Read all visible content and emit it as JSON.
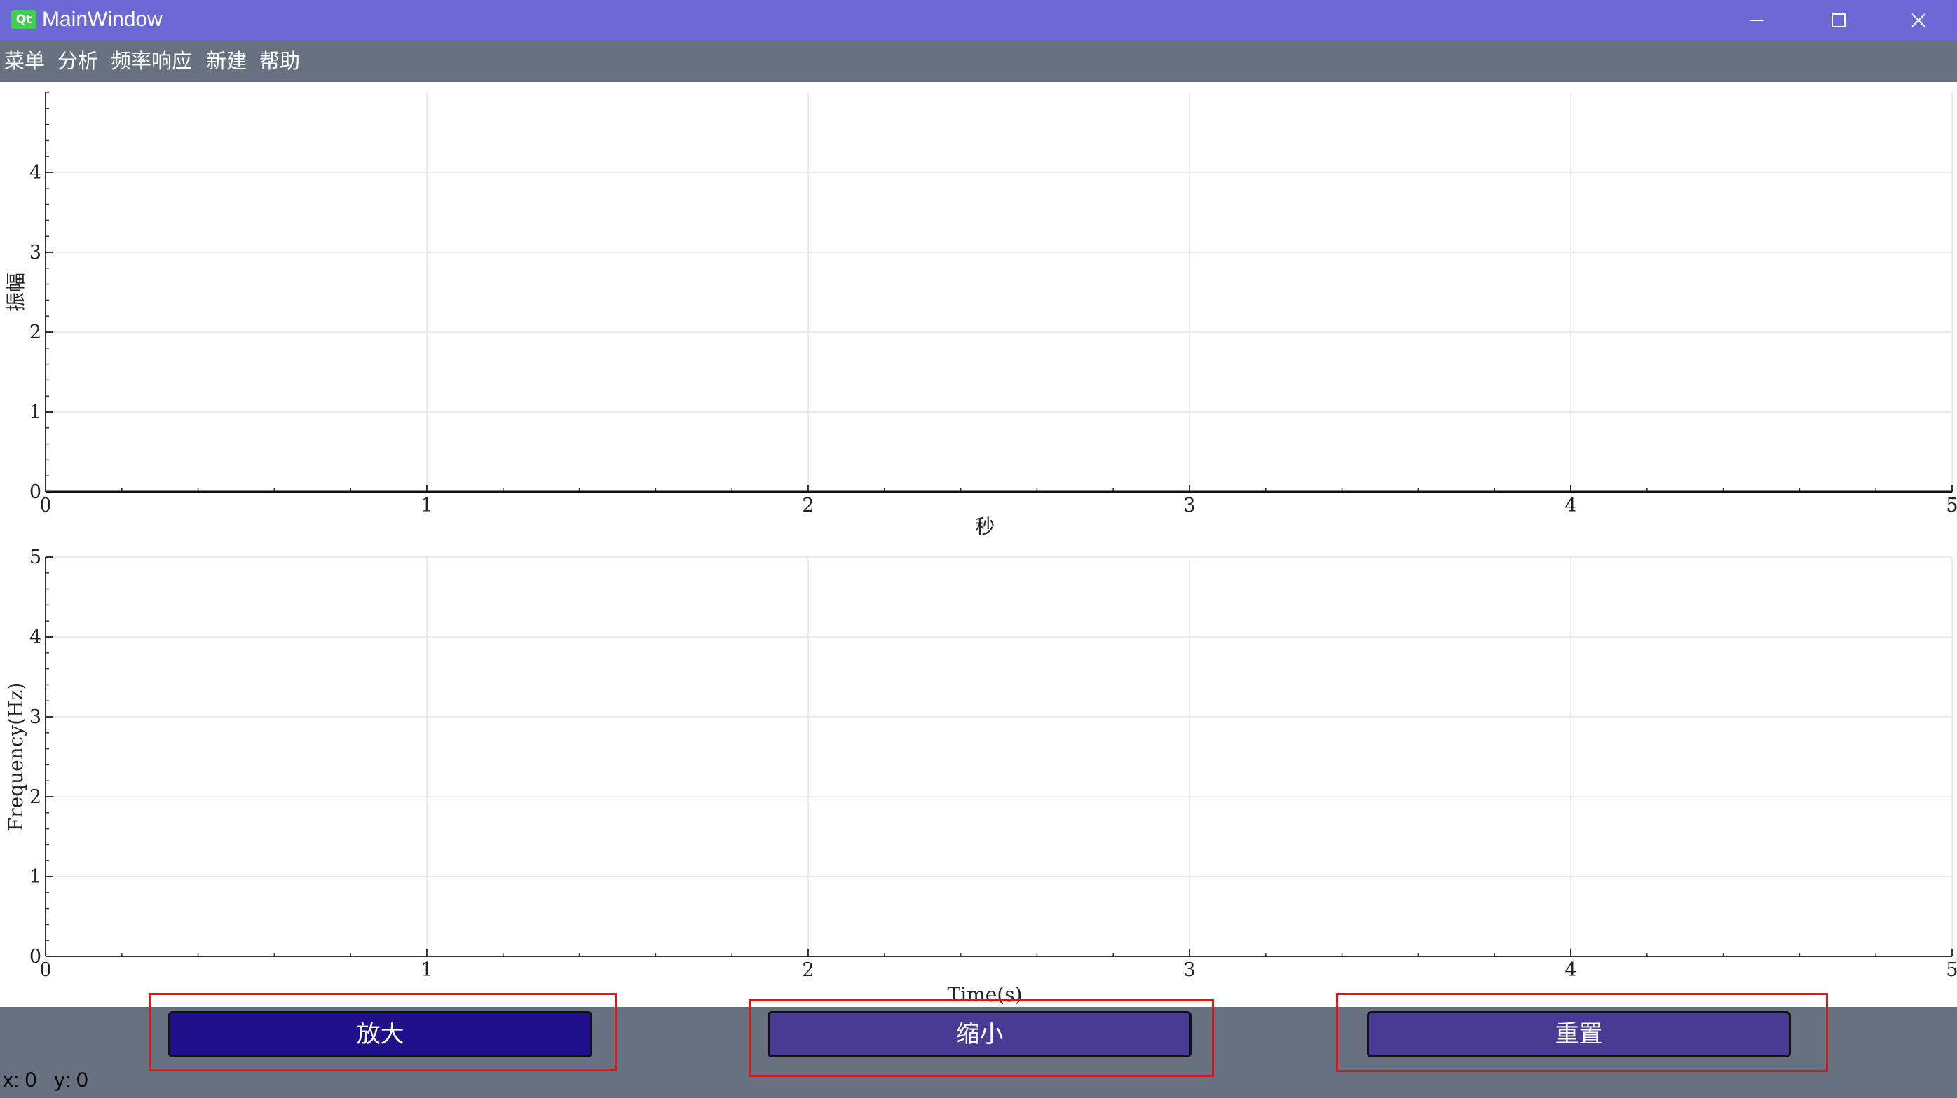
{
  "window": {
    "logo_text": "Qt",
    "title": "MainWindow",
    "controls": {
      "minimize": "minimize-icon",
      "maximize": "maximize-icon",
      "close": "close-icon"
    },
    "titlebar_color": "#6b67d4"
  },
  "menubar": {
    "items": [
      {
        "label": "菜单"
      },
      {
        "label": "分析"
      },
      {
        "label": "频率响应"
      },
      {
        "label": "新建"
      },
      {
        "label": "帮助"
      }
    ],
    "color": "#677180"
  },
  "chart_data": [
    {
      "type": "line",
      "title": "",
      "xlabel": "秒",
      "ylabel": "振幅",
      "xlim": [
        0,
        5
      ],
      "ylim": [
        0,
        5
      ],
      "x_ticks": [
        0,
        1,
        2,
        3,
        4,
        5
      ],
      "y_ticks": [
        0,
        1,
        2,
        3,
        4
      ],
      "grid": true,
      "series": [
        {
          "x": [
            0,
            5
          ],
          "y": [
            0,
            0
          ]
        }
      ]
    },
    {
      "type": "line",
      "title": "",
      "xlabel": "Time(s)",
      "ylabel": "Frequency(Hz)",
      "xlim": [
        0,
        5
      ],
      "ylim": [
        0,
        5
      ],
      "x_ticks": [
        0,
        1,
        2,
        3,
        4,
        5
      ],
      "y_ticks": [
        0,
        1,
        2,
        3,
        4,
        5
      ],
      "grid": true,
      "series": []
    }
  ],
  "controls": {
    "zoom_in_label": "放大",
    "zoom_out_label": "缩小",
    "reset_label": "重置",
    "zoom_in_color": "#21108c",
    "button_color": "#493b94",
    "highlight_color": "#e01616"
  },
  "status": {
    "x_text": "x: 0",
    "y_text": "y: 0"
  }
}
